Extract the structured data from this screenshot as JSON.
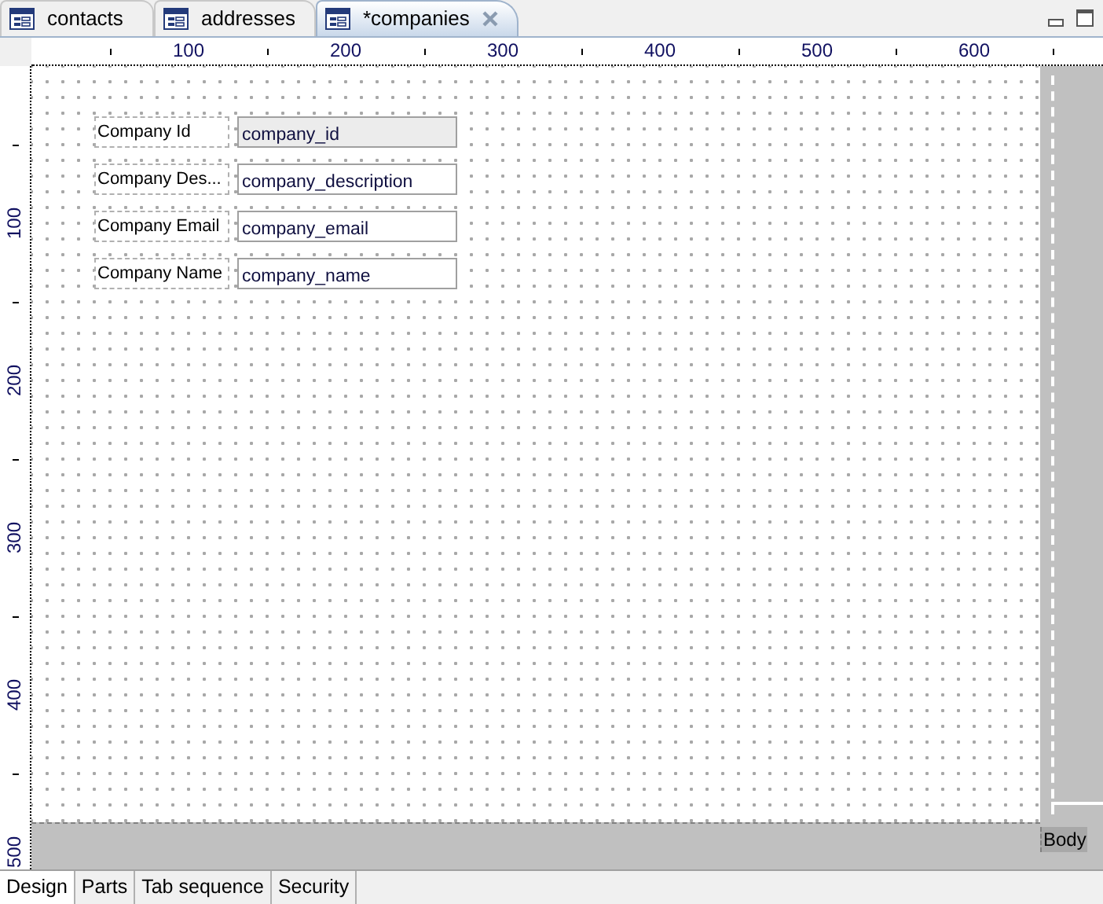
{
  "editor_tabs": [
    {
      "label": "contacts",
      "selected": false
    },
    {
      "label": "addresses",
      "selected": false
    },
    {
      "label": "*companies",
      "selected": true
    }
  ],
  "horizontal_ruler": [
    "100",
    "200",
    "300",
    "400",
    "500",
    "600"
  ],
  "vertical_ruler": [
    "100",
    "200",
    "300",
    "400",
    "500"
  ],
  "form_elements": [
    {
      "label": "Company Id",
      "field": "company_id",
      "read_only": true
    },
    {
      "label": "Company Des...",
      "field": "company_description",
      "read_only": false
    },
    {
      "label": "Company Email",
      "field": "company_email",
      "read_only": false
    },
    {
      "label": "Company Name",
      "field": "company_name",
      "read_only": false
    }
  ],
  "band_label": "Body",
  "bottom_tabs": [
    {
      "label": "Design",
      "selected": true
    },
    {
      "label": "Parts",
      "selected": false
    },
    {
      "label": "Tab sequence",
      "selected": false
    },
    {
      "label": "Security",
      "selected": false
    }
  ]
}
